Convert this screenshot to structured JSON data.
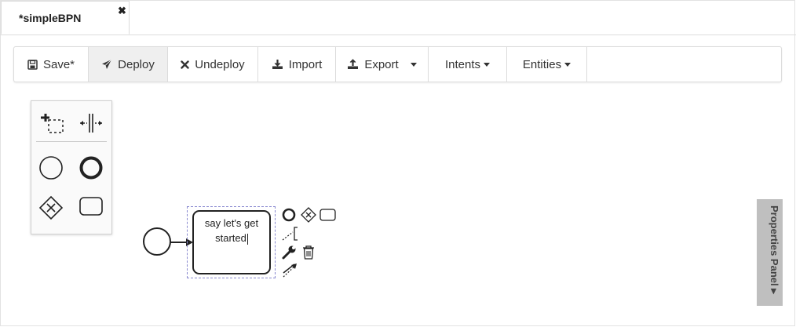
{
  "tab": {
    "title": "*simpleBPN",
    "close": "✖"
  },
  "toolbar": {
    "save": "Save*",
    "deploy": "Deploy",
    "undeploy": "Undeploy",
    "import": "Import",
    "export": "Export",
    "intents": "Intents",
    "entities": "Entities"
  },
  "palette": {
    "tools": [
      "lasso-tool-icon",
      "space-tool-icon",
      "start-event-icon",
      "end-event-icon",
      "gateway-icon",
      "task-icon"
    ]
  },
  "diagram": {
    "task_line1": "say let's get",
    "task_line2": "started"
  },
  "properties_panel": {
    "label": "Properties Panel ▸"
  }
}
